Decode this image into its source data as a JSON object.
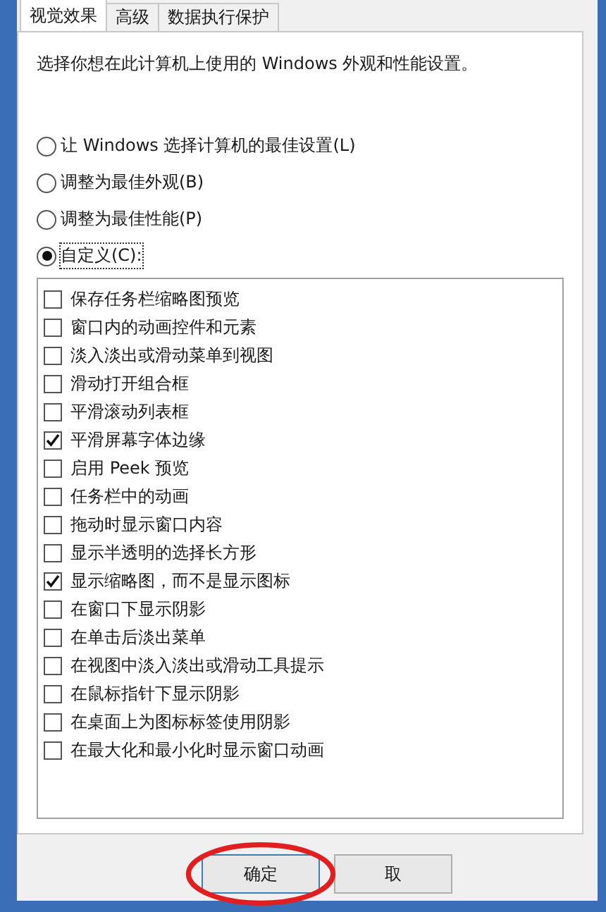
{
  "tabs": [
    {
      "label": "视觉效果",
      "selected": true
    },
    {
      "label": "高级",
      "selected": false
    },
    {
      "label": "数据执行保护",
      "selected": false
    }
  ],
  "description": "选择你想在此计算机上使用的 Windows 外观和性能设置。",
  "radios": [
    {
      "label": "让 Windows 选择计算机的最佳设置(L)",
      "selected": false
    },
    {
      "label": "调整为最佳外观(B)",
      "selected": false
    },
    {
      "label": "调整为最佳性能(P)",
      "selected": false
    },
    {
      "label": "自定义(C):",
      "selected": true
    }
  ],
  "options": [
    {
      "label": "保存任务栏缩略图预览",
      "checked": false
    },
    {
      "label": "窗口内的动画控件和元素",
      "checked": false
    },
    {
      "label": "淡入淡出或滑动菜单到视图",
      "checked": false
    },
    {
      "label": "滑动打开组合框",
      "checked": false
    },
    {
      "label": "平滑滚动列表框",
      "checked": false
    },
    {
      "label": "平滑屏幕字体边缘",
      "checked": true
    },
    {
      "label": "启用 Peek 预览",
      "checked": false
    },
    {
      "label": "任务栏中的动画",
      "checked": false
    },
    {
      "label": "拖动时显示窗口内容",
      "checked": false
    },
    {
      "label": "显示半透明的选择长方形",
      "checked": false
    },
    {
      "label": "显示缩略图，而不是显示图标",
      "checked": true
    },
    {
      "label": "在窗口下显示阴影",
      "checked": false
    },
    {
      "label": "在单击后淡出菜单",
      "checked": false
    },
    {
      "label": "在视图中淡入淡出或滑动工具提示",
      "checked": false
    },
    {
      "label": "在鼠标指针下显示阴影",
      "checked": false
    },
    {
      "label": "在桌面上为图标标签使用阴影",
      "checked": false
    },
    {
      "label": "在最大化和最小化时显示窗口动画",
      "checked": false
    }
  ],
  "buttons": [
    "确定",
    "取"
  ]
}
